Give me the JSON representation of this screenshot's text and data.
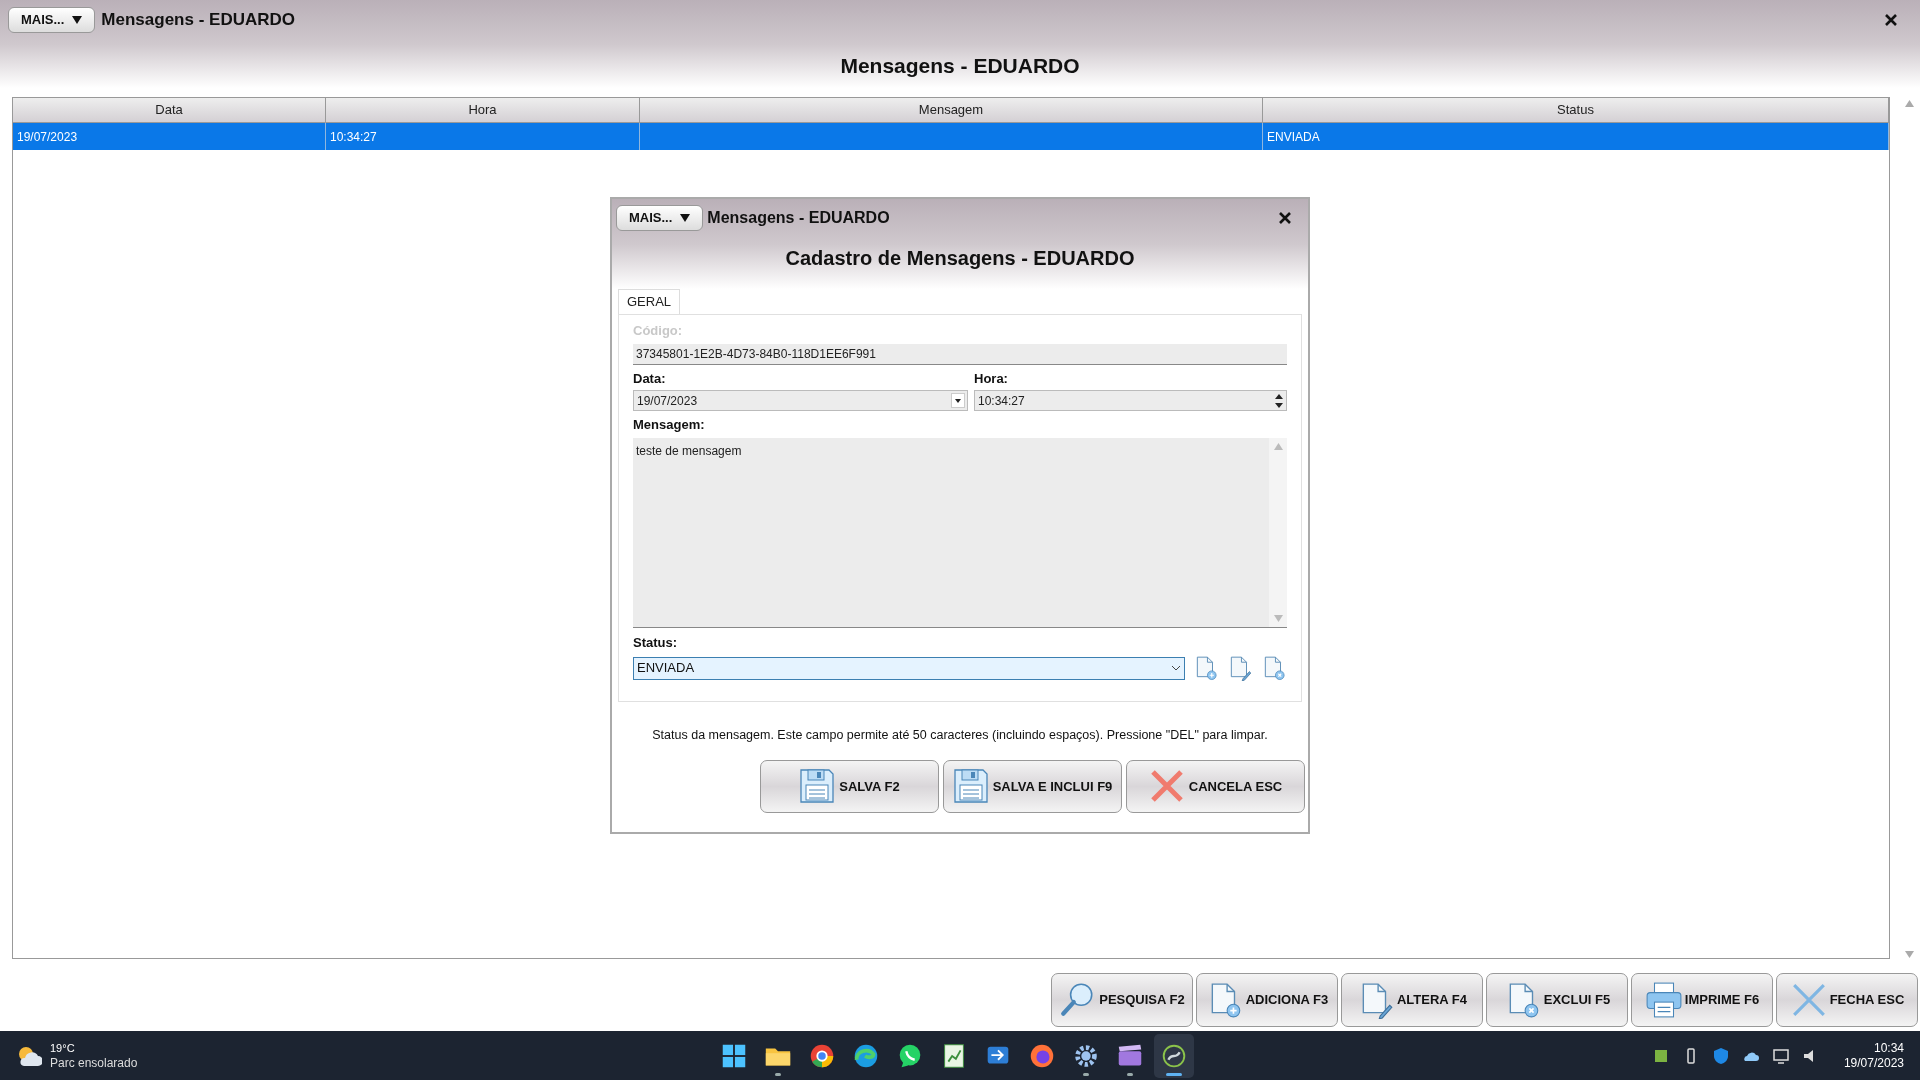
{
  "window": {
    "menu_button": "MAIS...",
    "title": "Mensagens - EDUARDO",
    "heading": "Mensagens - EDUARDO"
  },
  "table": {
    "columns": [
      "Data",
      "Hora",
      "Mensagem",
      "Status"
    ],
    "rows": [
      {
        "data": "19/07/2023",
        "hora": "10:34:27",
        "status": "ENVIADA",
        "selected": true
      }
    ]
  },
  "dialog": {
    "menu_button": "MAIS...",
    "title": "Mensagens - EDUARDO",
    "heading": "Cadastro de Mensagens - EDUARDO",
    "tabs": [
      {
        "label": "GERAL",
        "selected": true
      }
    ],
    "codigo": {
      "label": "Código:",
      "value": "37345801-1E2B-4D73-84B0-118D1EE6F991",
      "disabled": true
    },
    "data": {
      "label": "Data:",
      "value": "19/07/2023"
    },
    "hora": {
      "label": "Hora:",
      "value": "10:34:27"
    },
    "mensagem": {
      "label": "Mensagem:",
      "value": "teste de mensagem"
    },
    "status": {
      "label": "Status:",
      "value": "ENVIADA",
      "focused": true
    },
    "help": "Status da mensagem. Este campo permite até 50 caracteres (incluindo espaços). Pressione \"DEL\" para limpar.",
    "buttons": [
      {
        "label": "SALVA F2",
        "kind": "save"
      },
      {
        "label": "SALVA E INCLUI F9",
        "kind": "save"
      },
      {
        "label": "CANCELA ESC",
        "kind": "cancel"
      }
    ]
  },
  "toolbar": [
    {
      "label": "PESQUISA F2",
      "kind": "search"
    },
    {
      "label": "ADICIONA F3",
      "kind": "add"
    },
    {
      "label": "ALTERA F4",
      "kind": "edit"
    },
    {
      "label": "EXCLUI F5",
      "kind": "delete"
    },
    {
      "label": "IMPRIME F6",
      "kind": "print"
    },
    {
      "label": "FECHA ESC",
      "kind": "close"
    }
  ],
  "taskbar": {
    "weather": {
      "temp": "19°C",
      "desc": "Parc ensolarado"
    },
    "apps": [
      {
        "kind": "start",
        "running": false,
        "active": false
      },
      {
        "kind": "folder",
        "running": true,
        "active": false
      },
      {
        "kind": "chrome",
        "running": false,
        "active": false
      },
      {
        "kind": "edge",
        "running": false,
        "active": false
      },
      {
        "kind": "chat",
        "running": false,
        "active": false
      },
      {
        "kind": "sheet",
        "running": false,
        "active": false
      },
      {
        "kind": "mail",
        "running": false,
        "active": false
      },
      {
        "kind": "firefox",
        "running": false,
        "active": false
      },
      {
        "kind": "gear",
        "running": true,
        "active": false
      },
      {
        "kind": "clapper",
        "running": true,
        "active": false
      },
      {
        "kind": "app",
        "running": true,
        "active": true
      }
    ],
    "clock": {
      "time": "10:34",
      "date": "19/07/2023"
    }
  }
}
